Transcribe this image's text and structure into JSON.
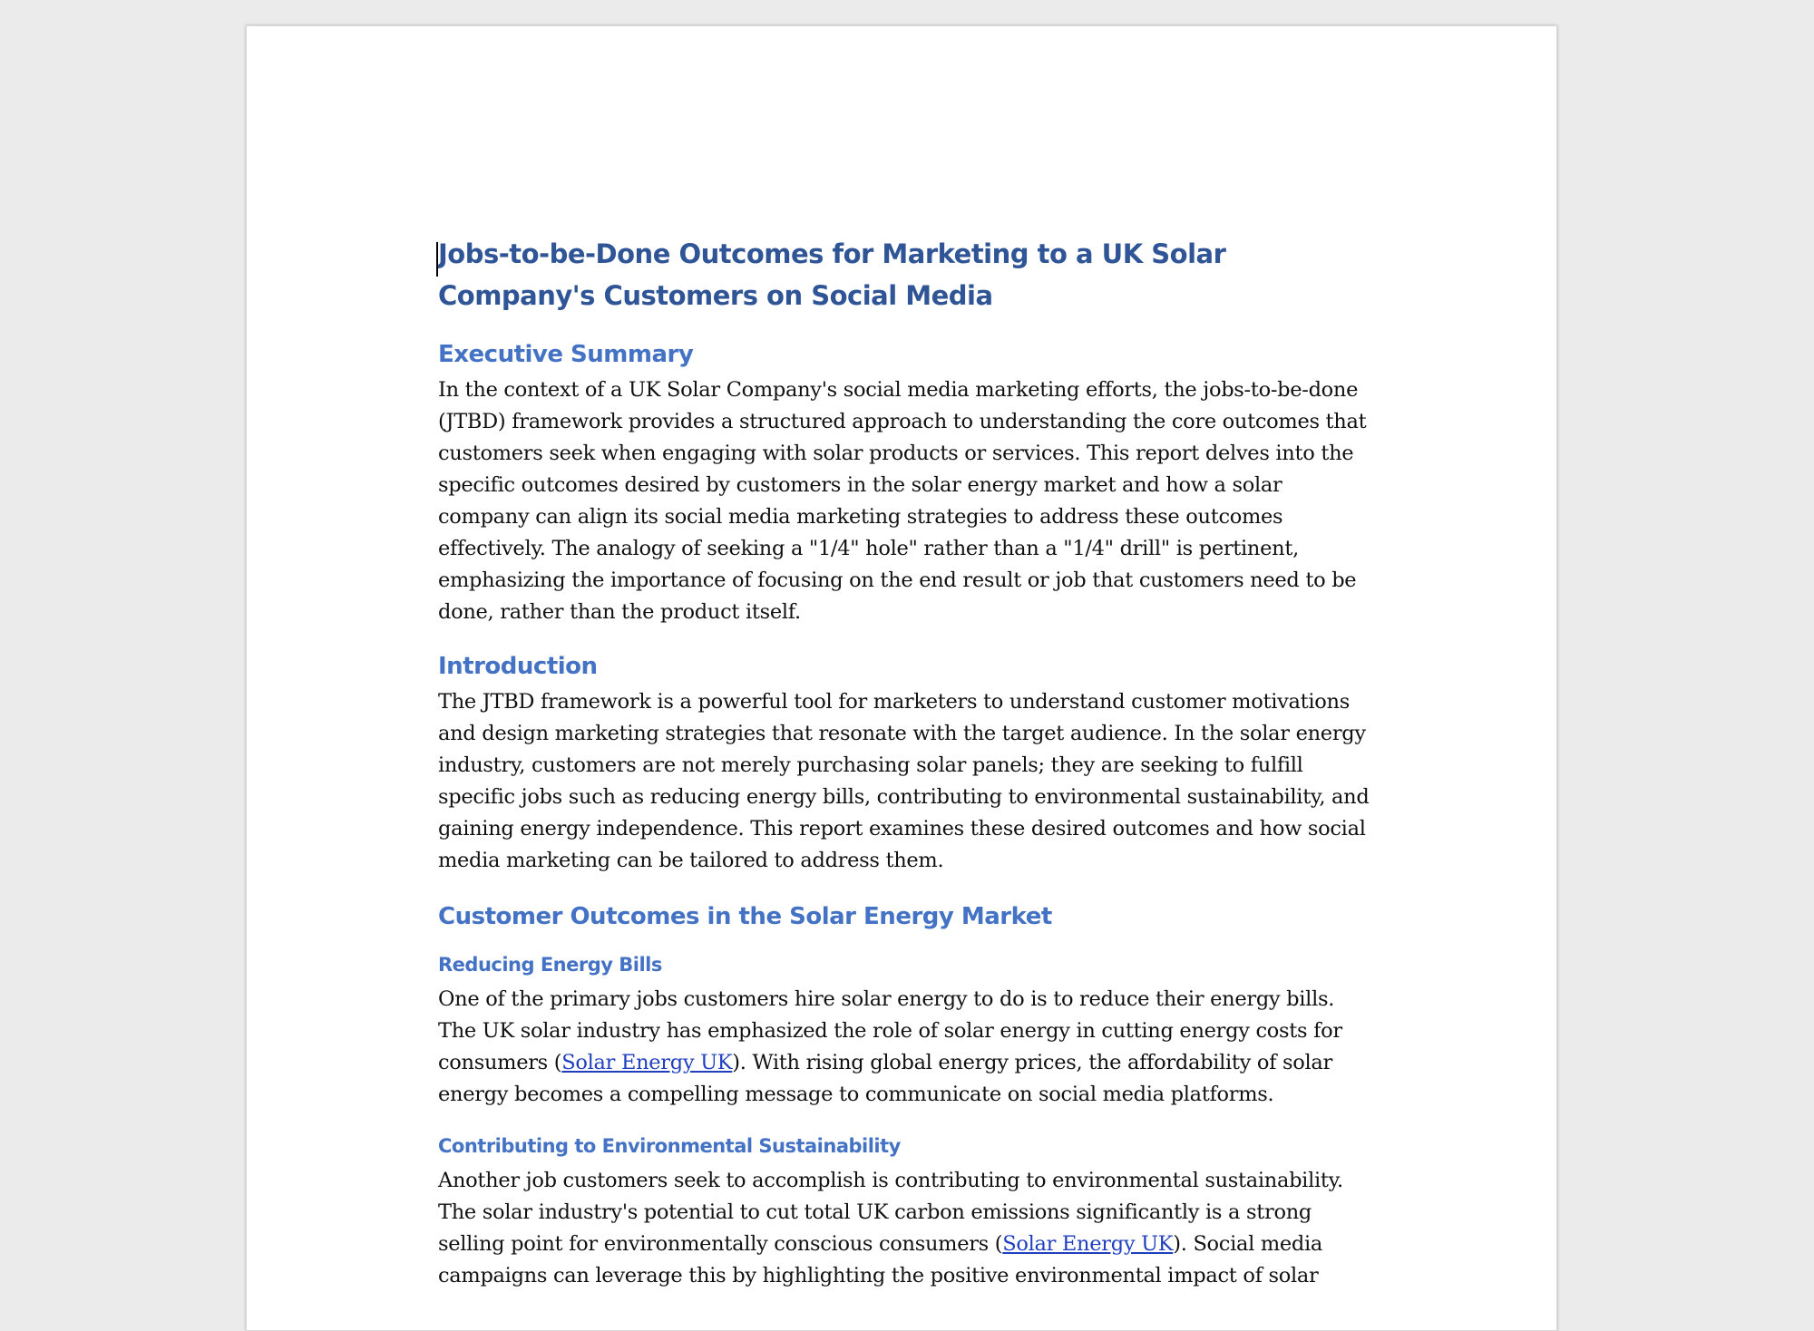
{
  "document": {
    "title": "Jobs-to-be-Done Outcomes for Marketing to a UK Solar Company's Customers on Social Media",
    "sections": {
      "executive_summary": {
        "heading": "Executive Summary",
        "body": "In the context of a UK Solar Company's social media marketing efforts, the jobs-to-be-done (JTBD) framework provides a structured approach to understanding the core outcomes that customers seek when engaging with solar products or services. This report delves into the specific outcomes desired by customers in the solar energy market and how a solar company can align its social media marketing strategies to address these outcomes effectively. The analogy of seeking a \"1/4\" hole\" rather than a \"1/4\" drill\" is pertinent, emphasizing the importance of focusing on the end result or job that customers need to be done, rather than the product itself."
      },
      "introduction": {
        "heading": "Introduction",
        "body": "The JTBD framework is a powerful tool for marketers to understand customer motivations and design marketing strategies that resonate with the target audience. In the solar energy industry, customers are not merely purchasing solar panels; they are seeking to fulfill specific jobs such as reducing energy bills, contributing to environmental sustainability, and gaining energy independence. This report examines these desired outcomes and how social media marketing can be tailored to address them."
      },
      "customer_outcomes": {
        "heading": "Customer Outcomes in the Solar Energy Market",
        "reducing_bills": {
          "heading": "Reducing Energy Bills",
          "body_before": "One of the primary jobs customers hire solar energy to do is to reduce their energy bills. The UK solar industry has emphasized the role of solar energy in cutting energy costs for consumers (",
          "link_text": "Solar Energy UK",
          "body_after": "). With rising global energy prices, the affordability of solar energy becomes a compelling message to communicate on social media platforms."
        },
        "environmental": {
          "heading": "Contributing to Environmental Sustainability",
          "body_before": "Another job customers seek to accomplish is contributing to environmental sustainability. The solar industry's potential to cut total UK carbon emissions significantly is a strong selling point for environmentally conscious consumers (",
          "link_text": "Solar Energy UK",
          "body_after": "). Social media campaigns can leverage this by highlighting the positive environmental impact of solar"
        }
      }
    }
  },
  "colors": {
    "title": "#2f5597",
    "heading": "#4472c4",
    "link": "#1f3fbf",
    "background": "#ebebeb",
    "page": "#ffffff"
  }
}
